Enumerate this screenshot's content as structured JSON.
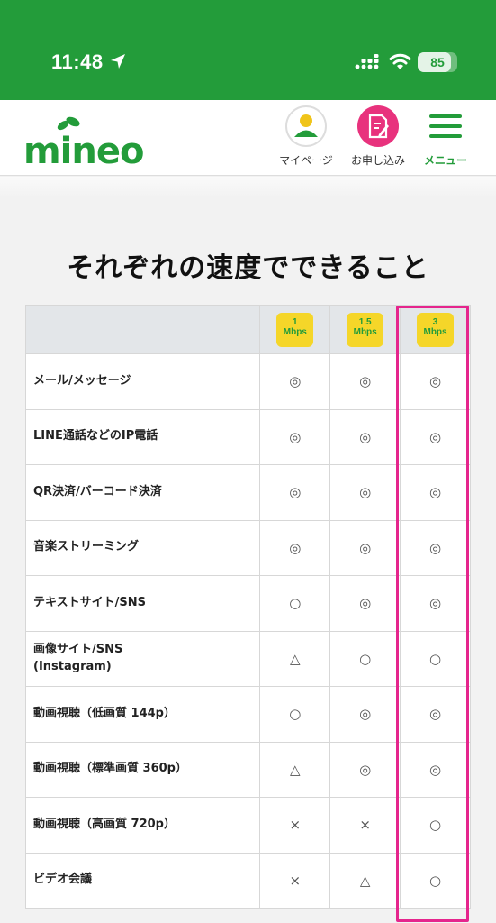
{
  "status_bar": {
    "time": "11:48",
    "battery": "85",
    "battery_level": 0.85,
    "icons": [
      "location-arrow-icon",
      "signal-icon",
      "wifi-icon",
      "battery-icon"
    ]
  },
  "header": {
    "logo_text": "mineo",
    "nav": {
      "mypage": "マイページ",
      "apply": "お申し込み",
      "menu": "メニュー"
    }
  },
  "colors": {
    "brand_green": "#239c3a",
    "accent_pink": "#e8327d",
    "badge_yellow": "#f5d629",
    "highlight_pink": "#e5258d"
  },
  "section": {
    "title": "それぞれの速度でできること"
  },
  "table": {
    "headers": [
      {
        "value": "1",
        "unit": "Mbps"
      },
      {
        "value": "1.5",
        "unit": "Mbps"
      },
      {
        "value": "3",
        "unit": "Mbps"
      }
    ],
    "rows": [
      {
        "label": "メール/メッセージ",
        "values": [
          "◎",
          "◎",
          "◎"
        ]
      },
      {
        "label": "LINE通話などのIP電話",
        "values": [
          "◎",
          "◎",
          "◎"
        ]
      },
      {
        "label": "QR決済/バーコード決済",
        "values": [
          "◎",
          "◎",
          "◎"
        ]
      },
      {
        "label": "音楽ストリーミング",
        "values": [
          "◎",
          "◎",
          "◎"
        ]
      },
      {
        "label": "テキストサイト/SNS",
        "values": [
          "○",
          "◎",
          "◎"
        ]
      },
      {
        "label": "画像サイト/SNS\n(Instagram)",
        "values": [
          "△",
          "○",
          "○"
        ]
      },
      {
        "label": "動画視聴（低画質 144p）",
        "values": [
          "○",
          "◎",
          "◎"
        ]
      },
      {
        "label": "動画視聴（標準画質 360p）",
        "values": [
          "△",
          "◎",
          "◎"
        ]
      },
      {
        "label": "動画視聴（高画質 720p）",
        "values": [
          "×",
          "×",
          "○"
        ]
      },
      {
        "label": "ビデオ会議",
        "values": [
          "×",
          "△",
          "○"
        ]
      }
    ]
  }
}
